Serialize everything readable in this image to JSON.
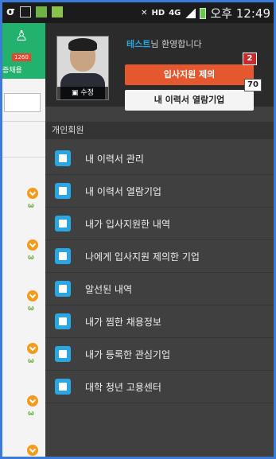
{
  "status_bar": {
    "carrier_icon": "σ",
    "net_label": "4G",
    "hd_label": "HD",
    "time": "오후 12:49"
  },
  "background_app": {
    "count": "1260",
    "label": "증채용"
  },
  "profile": {
    "name": "테스트",
    "greeting_suffix": "님 환영합니다",
    "photo_edit_label": "수정",
    "button_primary": "입사지원 제의",
    "button_primary_count": "2",
    "button_secondary": "내 이력서 열람기업",
    "button_secondary_count": "70"
  },
  "section_title": "개인회원",
  "menu": [
    {
      "label": "내 이력서 관리",
      "icon": "document-icon"
    },
    {
      "label": "내 이력서 열람기업",
      "icon": "id-card-icon"
    },
    {
      "label": "내가 입사지원한 내역",
      "icon": "mail-send-icon"
    },
    {
      "label": "나에게 입사지원 제의한 기업",
      "icon": "door-exit-icon"
    },
    {
      "label": "알선된 내역",
      "icon": "chat-icon"
    },
    {
      "label": "내가 찜한 채용정보",
      "icon": "star-icon"
    },
    {
      "label": "내가 등록한 관심기업",
      "icon": "checkmark-icon"
    },
    {
      "label": "대학 청년 고용센터",
      "icon": "graduation-cap-icon"
    }
  ],
  "colors": {
    "accent_blue": "#2aa7e3",
    "primary_button": "#e5572e",
    "drawer_bg": "#404040",
    "header_green": "#23b26d"
  }
}
